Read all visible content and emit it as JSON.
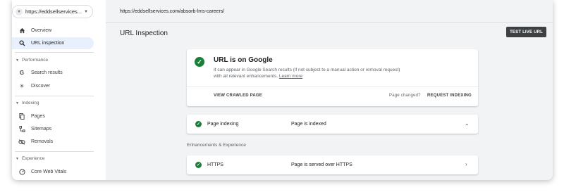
{
  "property_selector": {
    "label": "https://eddsellservices..."
  },
  "sidebar": {
    "overview": "Overview",
    "url_inspection": "URL inspection",
    "performance_section": "Performance",
    "search_results": "Search results",
    "discover": "Discover",
    "indexing_section": "Indexing",
    "pages": "Pages",
    "sitemaps": "Sitemaps",
    "removals": "Removals",
    "experience_section": "Experience",
    "core_web_vitals": "Core Web Vitals"
  },
  "header": {
    "url": "https://eddsellservices.com/absorb-lms-careers/",
    "page_title": "URL Inspection",
    "test_live_url": "TEST LIVE URL"
  },
  "status_card": {
    "title": "URL is on Google",
    "desc": "It can appear in Google Search results (if not subject to a manual action or removal request) with all relevant enhancements.",
    "learn_more": "Learn more",
    "view_crawled": "VIEW CRAWLED PAGE",
    "page_changed": "Page changed?",
    "request_indexing": "REQUEST INDEXING"
  },
  "indexing_row": {
    "label": "Page indexing",
    "value": "Page is indexed"
  },
  "enhancements_title": "Enhancements & Experience",
  "https_row": {
    "label": "HTTPS",
    "value": "Page is served over HTTPS"
  },
  "colors": {
    "success": "#188038",
    "active_nav": "#e8f0fe",
    "dark_button": "#3c4043"
  }
}
